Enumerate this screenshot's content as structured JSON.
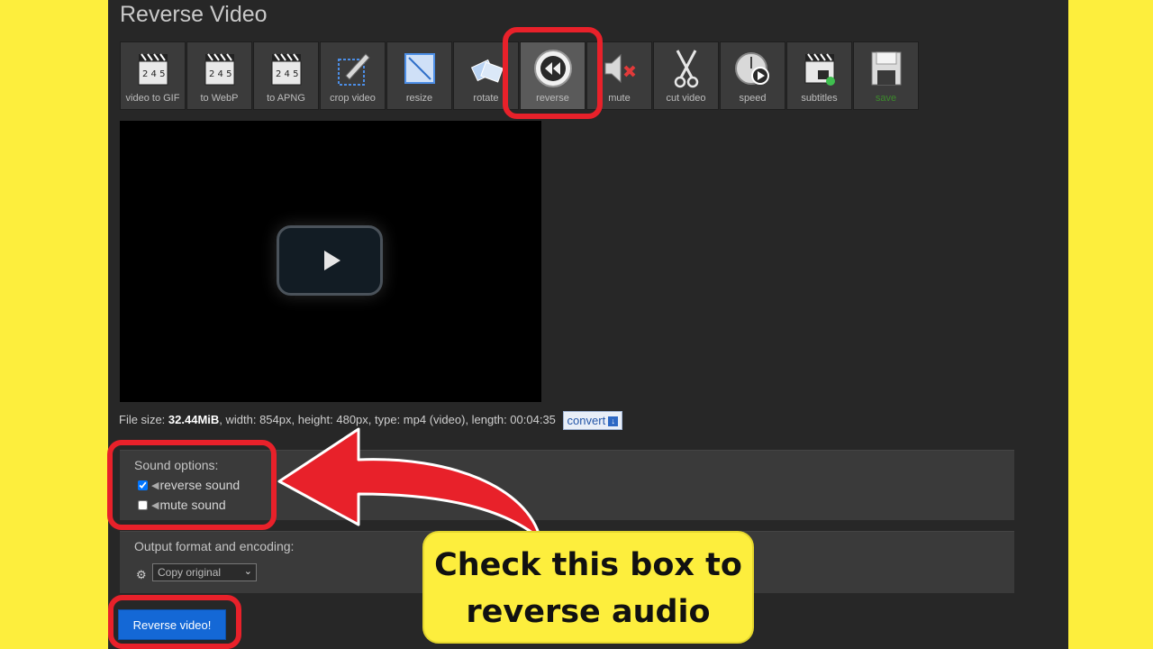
{
  "page": {
    "title": "Reverse Video"
  },
  "toolbar": {
    "tools": [
      {
        "label": "video to GIF",
        "icon": "clapperboard-icon"
      },
      {
        "label": "to WebP",
        "icon": "clapperboard-icon"
      },
      {
        "label": "to APNG",
        "icon": "clapperboard-icon"
      },
      {
        "label": "crop video",
        "icon": "crop-icon"
      },
      {
        "label": "resize",
        "icon": "resize-icon"
      },
      {
        "label": "rotate",
        "icon": "rotate-icon"
      },
      {
        "label": "reverse",
        "icon": "rewind-icon",
        "active": true
      },
      {
        "label": "mute",
        "icon": "mute-icon"
      },
      {
        "label": "cut video",
        "icon": "scissors-icon"
      },
      {
        "label": "speed",
        "icon": "speed-icon"
      },
      {
        "label": "subtitles",
        "icon": "subtitles-icon"
      },
      {
        "label": "save",
        "icon": "floppy-disk-icon"
      }
    ]
  },
  "file_info": {
    "prefix": "File size: ",
    "size": "32.44MiB",
    "details": ", width: 854px, height: 480px, type: mp4 (video), length: 00:04:35",
    "convert_label": "convert"
  },
  "sound_options": {
    "title": "Sound options:",
    "reverse_label": "reverse sound",
    "reverse_checked": true,
    "mute_label": "mute sound",
    "mute_checked": false
  },
  "output": {
    "title": "Output format and encoding:",
    "selected": "Copy original"
  },
  "action": {
    "label": "Reverse video!"
  },
  "callout": {
    "line1": "Check this box to",
    "line2": "reverse audio"
  },
  "colors": {
    "highlight": "#e8212a",
    "background": "#fdee3d",
    "button": "#1468d6"
  }
}
